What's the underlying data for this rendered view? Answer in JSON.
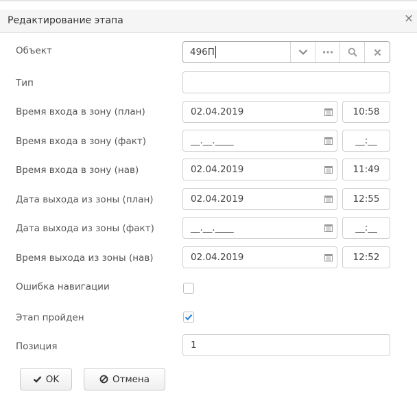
{
  "dialog": {
    "title": "Редактирование этапа"
  },
  "fields": {
    "object": {
      "label": "Объект",
      "value": "496П"
    },
    "type": {
      "label": "Тип",
      "value": ""
    },
    "entry_plan": {
      "label": "Время входа в зону (план)",
      "date": "02.04.2019",
      "time": "10:58"
    },
    "entry_fact": {
      "label": "Время входа в зону (факт)",
      "date": "__.__.____",
      "time": "__:__"
    },
    "entry_nav": {
      "label": "Время входа в зону (нав)",
      "date": "02.04.2019",
      "time": "11:49"
    },
    "exit_plan": {
      "label": "Дата выхода из зоны (план)",
      "date": "02.04.2019",
      "time": "12:55"
    },
    "exit_fact": {
      "label": "Дата выхода из зоны (факт)",
      "date": "__.__.____",
      "time": "__:__"
    },
    "exit_nav": {
      "label": "Время выхода из зоны (нав)",
      "date": "02.04.2019",
      "time": "12:52"
    },
    "nav_error": {
      "label": "Ошибка навигации",
      "checked": false
    },
    "stage_passed": {
      "label": "Этап пройден",
      "checked": true
    },
    "position": {
      "label": "Позиция",
      "value": "1"
    }
  },
  "buttons": {
    "ok": "OK",
    "cancel": "Отмена"
  },
  "icons": {
    "close": "close-icon",
    "dropdown": "chevron-down-icon",
    "more": "ellipsis-icon",
    "search": "search-icon",
    "clear": "clear-icon",
    "calendar": "calendar-icon",
    "check": "check-icon",
    "cancel": "ban-icon"
  },
  "colors": {
    "accent": "#2a7fd6",
    "border": "#cfcfcf",
    "titlebar": "#f5f5f5"
  }
}
